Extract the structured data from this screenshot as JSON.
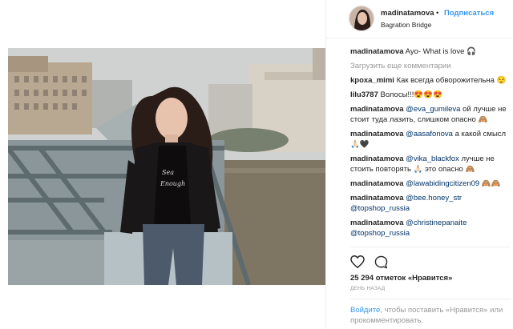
{
  "header": {
    "username": "madinatamova",
    "separator": "•",
    "follow_label": "Подписаться",
    "location": "Bagration Bridge"
  },
  "caption": {
    "username": "madinatamova",
    "text": "Ayo- What is love 🎧"
  },
  "load_more_label": "Загрузить еще комментарии",
  "comments": [
    {
      "username": "kpoxa_mimi",
      "text": "Как всегда обворожительна 😌",
      "mention": "",
      "rest": ""
    },
    {
      "username": "lilu3787",
      "text": "Волосы!!!😍😍😍",
      "mention": "",
      "rest": ""
    },
    {
      "username": "madinatamova",
      "text": "",
      "mention": "@eva_gumileva",
      "rest": " ой лучше не стоит туда лазить, слишком опасно 🙈"
    },
    {
      "username": "madinatamova",
      "text": "",
      "mention": "@aasafonova",
      "rest": " а какой смысл 🙏🏻🖤"
    },
    {
      "username": "madinatamova",
      "text": "",
      "mention": "@vika_blackfox",
      "rest": " лучше не стоить повторять 🙏🏻 это опасно 🙈"
    },
    {
      "username": "madinatamova",
      "text": "",
      "mention": "@lawabidingcitizen09",
      "rest": " 🙈🙈"
    },
    {
      "username": "madinatamova",
      "text": "",
      "mention": "@bee.honey_str",
      "rest": "",
      "mention2": "@topshop_russia"
    },
    {
      "username": "madinatamova",
      "text": "",
      "mention": "@christinepanaite",
      "rest": "",
      "mention2": "@topshop_russia"
    }
  ],
  "likes_text": "25 294 отметок «Нравится»",
  "time_ago": "ДЕНЬ НАЗАД",
  "footer": {
    "login_link": "Войдите",
    "rest": ", чтобы поставить «Нравится» или прокомментировать."
  },
  "colors": {
    "link_blue": "#3897f0",
    "mention_blue": "#003569",
    "muted_gray": "#999999",
    "text": "#262626"
  },
  "icons": [
    "heart-icon",
    "comment-icon"
  ]
}
